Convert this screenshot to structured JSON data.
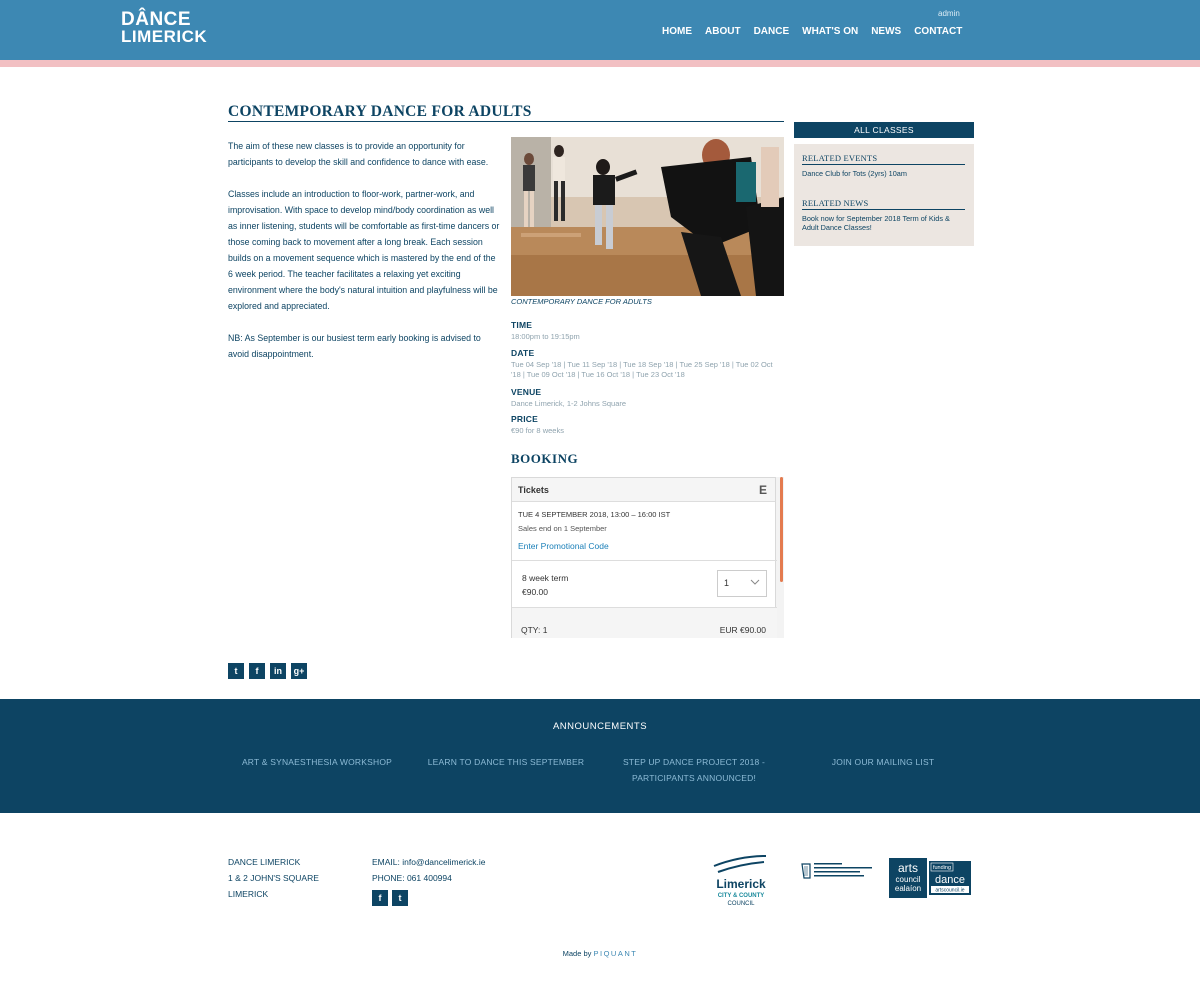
{
  "header": {
    "logo_line1": "DÂNCE",
    "logo_line2": "LIMERICK",
    "admin": "admin",
    "nav": [
      "HOME",
      "ABOUT",
      "DANCE",
      "WHAT'S ON",
      "NEWS",
      "CONTACT"
    ]
  },
  "main": {
    "title": "CONTEMPORARY DANCE FOR ADULTS",
    "paragraphs": [
      "The aim of these new classes is to provide an opportunity for participants to develop the skill and confidence to dance with ease.",
      "Classes include an introduction to floor-work, partner-work, and improvisation. With space to develop mind/body coordination as well as inner listening, students will be comfortable as first-time dancers or those coming back to movement after a long break. Each session builds on a movement sequence which is mastered by the end of the 6 week period. The teacher facilitates a relaxing yet exciting environment where the body's natural intuition and playfulness will be explored and appreciated.",
      "NB: As September is our busiest term early booking is advised to avoid disappointment."
    ],
    "photo_caption": "CONTEMPORARY DANCE FOR ADULTS",
    "time_label": "TIME",
    "time_value": "18:00pm to 19:15pm",
    "date_label": "DATE",
    "date_value": "Tue 04 Sep '18 | Tue 11 Sep '18 | Tue 18 Sep '18 | Tue 25 Sep '18 | Tue 02 Oct '18 | Tue 09 Oct '18 | Tue 16 Oct '18 | Tue 23 Oct '18",
    "venue_label": "VENUE",
    "venue_value": "Dance Limerick, 1-2 Johns Square",
    "price_label": "PRICE",
    "price_value": "€90 for 8 weeks",
    "booking_title": "BOOKING"
  },
  "widget": {
    "header": "Tickets",
    "brand_icon": "E",
    "date": "TUE 4 SEPTEMBER 2018, 13:00 – 16:00 IST",
    "sales_end": "Sales end on 1 September",
    "promo": "Enter Promotional Code",
    "ticket_name": "8 week term",
    "ticket_price": "€90.00",
    "qty_selected": "1",
    "qty_label": "QTY: 1",
    "total": "EUR €90.00"
  },
  "sidebar": {
    "header": "ALL CLASSES",
    "related_events_title": "RELATED EVENTS",
    "related_events_item": "Dance Club for Tots (2yrs) 10am",
    "related_news_title": "RELATED NEWS",
    "related_news_item": "Book now for September 2018 Term of Kids & Adult Dance Classes!"
  },
  "social": {
    "twitter": "t",
    "facebook": "f",
    "linkedin": "in",
    "googleplus": "g+"
  },
  "announcements": {
    "title": "ANNOUNCEMENTS",
    "items": [
      "ART & SYNAESTHESIA WORKSHOP",
      "LEARN TO DANCE THIS SEPTEMBER",
      "STEP UP DANCE PROJECT 2018 - PARTICIPANTS ANNOUNCED!",
      "JOIN OUR MAILING LIST"
    ]
  },
  "footer": {
    "address_lines": [
      "DANCE LIMERICK",
      "1 & 2 JOHN'S SQUARE",
      "LIMERICK"
    ],
    "email": "EMAIL: info@dancelimerick.ie",
    "phone": "PHONE: 061 400994",
    "made_by": "Made by",
    "made_by_brand": "PIQUANT",
    "logo_limerick_line1": "Limerick",
    "logo_limerick_line2": "CITY & COUNTY",
    "logo_limerick_line3": "COUNCIL",
    "logo_arts_line1": "arts",
    "logo_arts_line2": "council",
    "logo_arts_line3": "ealaíon",
    "logo_arts_badge1": "funding",
    "logo_arts_badge2": "dance",
    "logo_arts_badge3": "artscouncil.ie"
  },
  "colors": {
    "header_blue": "#3d88b3",
    "navy": "#0d4463",
    "pink_stripe": "#f2c0c3",
    "sidebar_bg": "#ece6e1",
    "eventbrite_orange": "#e47b4f"
  }
}
